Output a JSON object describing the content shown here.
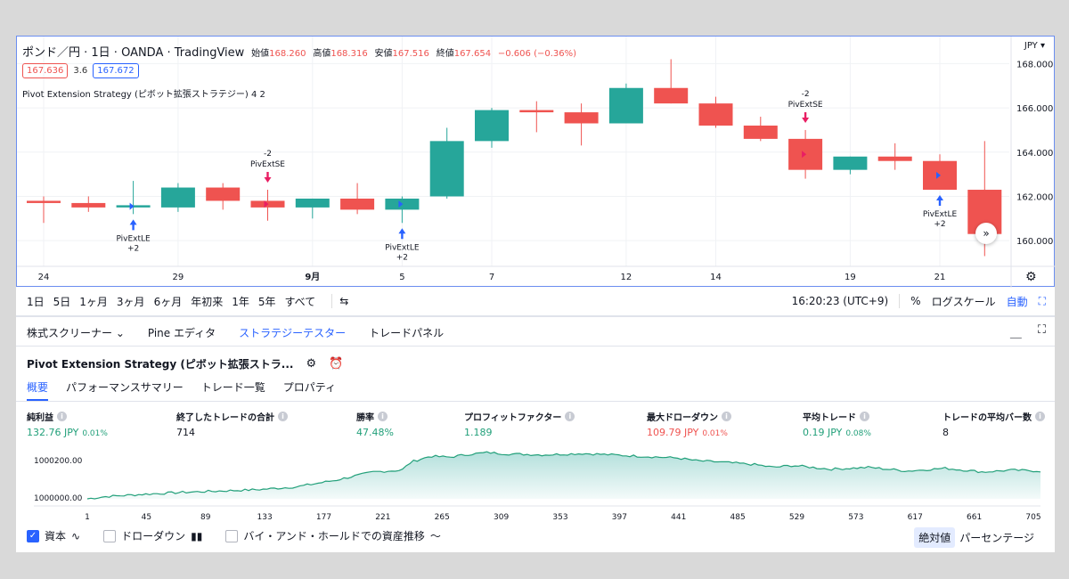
{
  "header": {
    "symbol": "ポンド／円 · 1日 · OANDA · TradingView",
    "open_label": "始値",
    "open": "168.260",
    "high_label": "高値",
    "high": "168.316",
    "low_label": "安値",
    "low": "167.516",
    "close_label": "終値",
    "close": "167.654",
    "change": "−0.606 (−0.36%)",
    "sell_price": "167.636",
    "spread": "3.6",
    "buy_price": "167.672",
    "strategy_line": "Pivot Extension Strategy (ピボット拡張ストラテジー) 4 2",
    "currency": "JPY ▾"
  },
  "chart_data": {
    "type": "candlestick",
    "price_axis": {
      "min": 159,
      "max": 168.5,
      "ticks": [
        "168.000",
        "166.000",
        "164.000",
        "162.000",
        "160.000"
      ],
      "tick_values": [
        168,
        166,
        164,
        162,
        160
      ]
    },
    "x_tick_labels": [
      {
        "label": "24",
        "index": 0
      },
      {
        "label": "29",
        "index": 3
      },
      {
        "label": "9月",
        "index": 6
      },
      {
        "label": "5",
        "index": 8
      },
      {
        "label": "7",
        "index": 10
      },
      {
        "label": "12",
        "index": 13
      },
      {
        "label": "14",
        "index": 15
      },
      {
        "label": "19",
        "index": 18
      },
      {
        "label": "21",
        "index": 20
      }
    ],
    "candles": [
      {
        "o": 161.8,
        "h": 162.0,
        "l": 160.8,
        "c": 161.7
      },
      {
        "o": 161.7,
        "h": 162.0,
        "l": 161.3,
        "c": 161.5
      },
      {
        "o": 161.5,
        "h": 162.7,
        "l": 161.2,
        "c": 161.6
      },
      {
        "o": 161.5,
        "h": 162.6,
        "l": 161.3,
        "c": 162.4
      },
      {
        "o": 162.4,
        "h": 162.6,
        "l": 161.4,
        "c": 161.8
      },
      {
        "o": 161.8,
        "h": 162.3,
        "l": 160.9,
        "c": 161.5
      },
      {
        "o": 161.5,
        "h": 161.9,
        "l": 161.0,
        "c": 161.9
      },
      {
        "o": 161.9,
        "h": 162.6,
        "l": 161.2,
        "c": 161.4
      },
      {
        "o": 161.4,
        "h": 162.0,
        "l": 160.8,
        "c": 161.9
      },
      {
        "o": 162.0,
        "h": 165.1,
        "l": 161.9,
        "c": 164.5
      },
      {
        "o": 164.5,
        "h": 166.0,
        "l": 164.2,
        "c": 165.9
      },
      {
        "o": 165.9,
        "h": 166.3,
        "l": 164.9,
        "c": 165.8
      },
      {
        "o": 165.8,
        "h": 166.2,
        "l": 164.3,
        "c": 165.3
      },
      {
        "o": 165.3,
        "h": 167.1,
        "l": 165.3,
        "c": 166.9
      },
      {
        "o": 166.9,
        "h": 168.2,
        "l": 166.2,
        "c": 166.2
      },
      {
        "o": 166.2,
        "h": 166.5,
        "l": 165.1,
        "c": 165.2
      },
      {
        "o": 165.2,
        "h": 165.6,
        "l": 164.5,
        "c": 164.6
      },
      {
        "o": 164.6,
        "h": 165.0,
        "l": 162.8,
        "c": 163.2
      },
      {
        "o": 163.2,
        "h": 163.8,
        "l": 163.0,
        "c": 163.8
      },
      {
        "o": 163.8,
        "h": 164.4,
        "l": 163.2,
        "c": 163.6
      },
      {
        "o": 163.6,
        "h": 163.9,
        "l": 162.3,
        "c": 162.3
      },
      {
        "o": 162.3,
        "h": 164.5,
        "l": 159.3,
        "c": 160.3
      }
    ],
    "signals": [
      {
        "index": 2,
        "side": "long",
        "name": "PivExtLE",
        "qty": "+2"
      },
      {
        "index": 5,
        "side": "short",
        "name": "PivExtSE",
        "qty": "-2"
      },
      {
        "index": 8,
        "side": "long",
        "name": "PivExtLE",
        "qty": "+2"
      },
      {
        "index": 17,
        "side": "short",
        "name": "PivExtSE",
        "qty": "-2"
      },
      {
        "index": 20,
        "side": "long",
        "name": "PivExtLE",
        "qty": "+2"
      }
    ]
  },
  "toolbar": {
    "timeframes": [
      "1日",
      "5日",
      "1ヶ月",
      "3ヶ月",
      "6ヶ月",
      "年初来",
      "1年",
      "5年",
      "すべて"
    ],
    "time": "16:20:23 (UTC+9)",
    "percent": "%",
    "log": "ログスケール",
    "auto": "自動"
  },
  "bottom_tabs": [
    "株式スクリーナー ⌄",
    "Pine エディタ",
    "ストラテジーテスター",
    "トレードパネル"
  ],
  "strategy": {
    "title": "Pivot Extension Strategy (ピボット拡張ストラ...",
    "sub_tabs": [
      "概要",
      "パフォーマンスサマリー",
      "トレード一覧",
      "プロパティ"
    ]
  },
  "metrics": [
    {
      "label": "純利益",
      "value": "132.76 JPY",
      "pct": "0.01%",
      "color": "green"
    },
    {
      "label": "終了したトレードの合計",
      "value": "714",
      "pct": "",
      "color": "black"
    },
    {
      "label": "勝率",
      "value": "47.48%",
      "pct": "",
      "color": "green"
    },
    {
      "label": "プロフィットファクター",
      "value": "1.189",
      "pct": "",
      "color": "green"
    },
    {
      "label": "最大ドローダウン",
      "value": "109.79 JPY",
      "pct": "0.01%",
      "color": "red"
    },
    {
      "label": "平均トレード",
      "value": "0.19 JPY",
      "pct": "0.08%",
      "color": "green"
    },
    {
      "label": "トレードの平均バー数",
      "value": "8",
      "pct": "",
      "color": "black"
    }
  ],
  "equity_chart": {
    "y_labels": [
      "1000200.00",
      "1000000.00"
    ],
    "x_labels": [
      "1",
      "45",
      "89",
      "133",
      "177",
      "221",
      "265",
      "309",
      "353",
      "397",
      "441",
      "485",
      "529",
      "573",
      "617",
      "661",
      "705"
    ],
    "profile": [
      [
        0,
        0.0
      ],
      [
        0.02,
        0.05
      ],
      [
        0.06,
        0.1
      ],
      [
        0.1,
        0.14
      ],
      [
        0.14,
        0.17
      ],
      [
        0.18,
        0.2
      ],
      [
        0.22,
        0.26
      ],
      [
        0.26,
        0.4
      ],
      [
        0.3,
        0.58
      ],
      [
        0.33,
        0.62
      ],
      [
        0.34,
        0.8
      ],
      [
        0.36,
        0.92
      ],
      [
        0.38,
        0.9
      ],
      [
        0.4,
        0.96
      ],
      [
        0.42,
        1.0
      ],
      [
        0.44,
        0.97
      ],
      [
        0.48,
        0.95
      ],
      [
        0.52,
        0.98
      ],
      [
        0.56,
        0.94
      ],
      [
        0.6,
        0.9
      ],
      [
        0.62,
        0.88
      ],
      [
        0.64,
        0.82
      ],
      [
        0.66,
        0.8
      ],
      [
        0.7,
        0.74
      ],
      [
        0.72,
        0.68
      ],
      [
        0.74,
        0.72
      ],
      [
        0.78,
        0.64
      ],
      [
        0.82,
        0.68
      ],
      [
        0.86,
        0.6
      ],
      [
        0.9,
        0.66
      ],
      [
        0.94,
        0.58
      ],
      [
        0.97,
        0.62
      ],
      [
        1.0,
        0.6
      ]
    ]
  },
  "options": [
    {
      "label": "資本",
      "checked": true,
      "icon": "∿"
    },
    {
      "label": "ドローダウン",
      "checked": false,
      "icon": "▮▮"
    },
    {
      "label": "バイ・アンド・ホールドでの資産推移",
      "checked": false,
      "icon": "〜"
    }
  ],
  "modes": [
    "絶対値",
    "パーセンテージ"
  ],
  "colors": {
    "up": "#26a69a",
    "down": "#ef5350",
    "accent": "#2962ff"
  }
}
